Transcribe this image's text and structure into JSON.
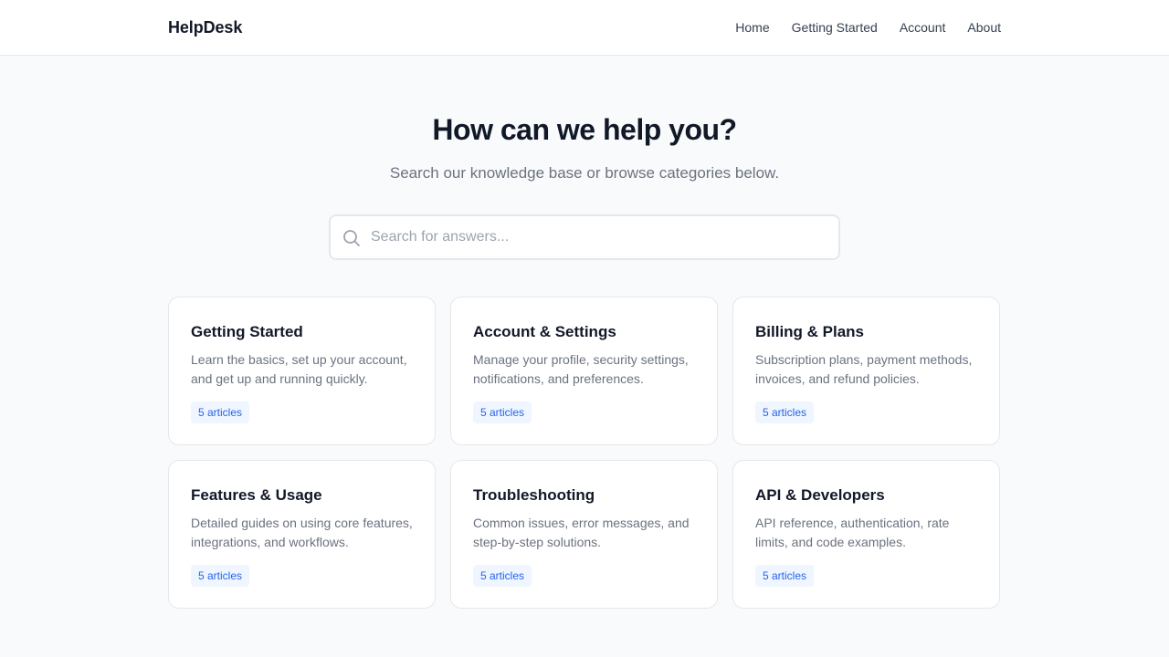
{
  "header": {
    "brand": "HelpDesk",
    "nav": [
      "Home",
      "Getting Started",
      "Account",
      "About"
    ]
  },
  "hero": {
    "title": "How can we help you?",
    "subtitle": "Search our knowledge base or browse categories below."
  },
  "search": {
    "placeholder": "Search for answers...",
    "value": "",
    "icon": "search-icon"
  },
  "categories": [
    {
      "title": "Getting Started",
      "description": "Learn the basics, set up your account, and get up and running quickly.",
      "count": "5 articles"
    },
    {
      "title": "Account & Settings",
      "description": "Manage your profile, security settings, notifications, and preferences.",
      "count": "5 articles"
    },
    {
      "title": "Billing & Plans",
      "description": "Subscription plans, payment methods, invoices, and refund policies.",
      "count": "5 articles"
    },
    {
      "title": "Features & Usage",
      "description": "Detailed guides on using core features, integrations, and workflows.",
      "count": "5 articles"
    },
    {
      "title": "Troubleshooting",
      "description": "Common issues, error messages, and step-by-step solutions.",
      "count": "5 articles"
    },
    {
      "title": "API & Developers",
      "description": "API reference, authentication, rate limits, and code examples.",
      "count": "5 articles"
    }
  ],
  "colors": {
    "background": "#f9fafb",
    "accent": "#2563eb",
    "badge_bg": "#eff6ff",
    "text_primary": "#111827",
    "text_muted": "#6b7280"
  }
}
